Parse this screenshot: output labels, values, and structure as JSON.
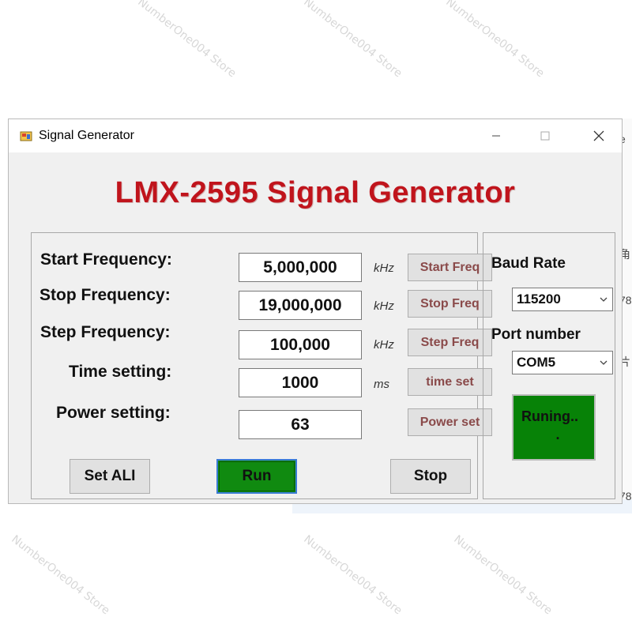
{
  "window": {
    "title": "Signal Generator"
  },
  "app_heading": "LMX-2595 Signal Generator",
  "settings": {
    "start_frequency": {
      "label": "Start Frequency:",
      "value": "5,000,000",
      "unit": "kHz",
      "button": "Start Freq"
    },
    "stop_frequency": {
      "label": "Stop Frequency:",
      "value": "19,000,000",
      "unit": "kHz",
      "button": "Stop Freq"
    },
    "step_frequency": {
      "label": "Step Frequency:",
      "value": "100,000",
      "unit": "kHz",
      "button": "Step Freq"
    },
    "time_setting": {
      "label": "Time setting:",
      "value": "1000",
      "unit": "ms",
      "button": "time set"
    },
    "power_setting": {
      "label": "Power setting:",
      "value": "63",
      "unit": "",
      "button": "Power set"
    }
  },
  "actions": {
    "set_ali": "Set ALI",
    "run": "Run",
    "stop": "Stop"
  },
  "serial": {
    "baud_rate_label": "Baud Rate",
    "baud_rate_value": "115200",
    "port_label": "Port number",
    "port_value": "COM5",
    "status_text": "Runing..",
    "status_dot": "."
  },
  "watermark": "NumberOne004 Store",
  "background_app": {
    "chars": [
      "e",
      "角",
      "78",
      "片",
      "78"
    ]
  },
  "colors": {
    "heading_red": "#c0141c",
    "status_green": "#078207",
    "run_green": "#108a10"
  }
}
